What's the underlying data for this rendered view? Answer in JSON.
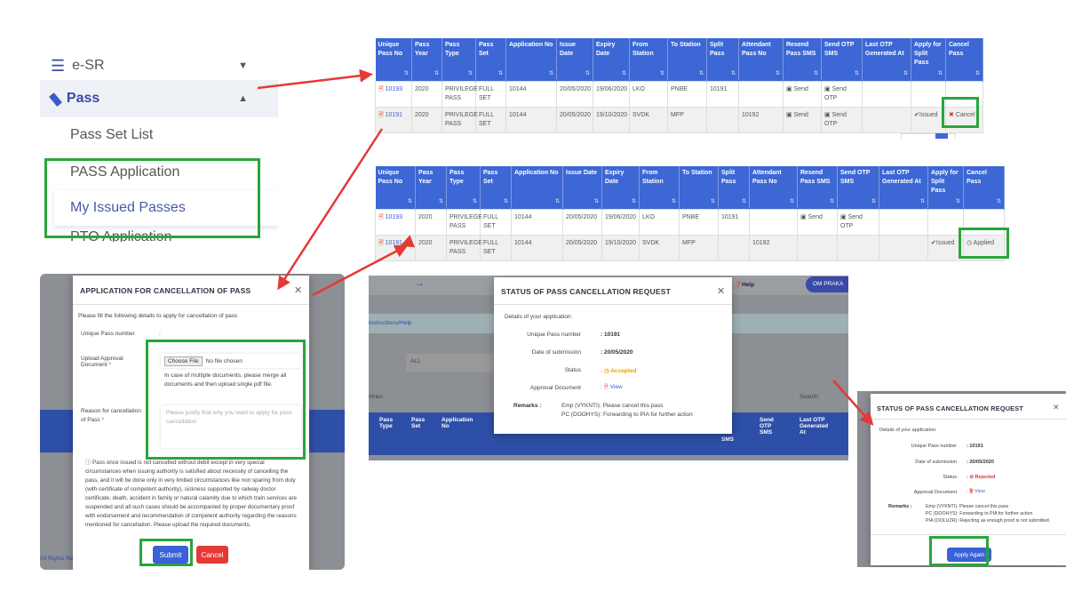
{
  "sidebar": {
    "items": [
      {
        "label": "e-SR",
        "icon": "database-icon"
      },
      {
        "label": "Pass",
        "icon": "ticket-icon"
      },
      {
        "label": "Pass Set List"
      },
      {
        "label": "PASS Application"
      },
      {
        "label": "My Issued Passes"
      },
      {
        "label": "PTO Application"
      }
    ]
  },
  "table_headers": [
    "Unique Pass No",
    "Pass Year",
    "Pass Type",
    "Pass Set",
    "Application No",
    "Issue Date",
    "Expiry Date",
    "From Station",
    "To Station",
    "Split Pass",
    "Attendant Pass No",
    "Resend Pass SMS",
    "Send OTP SMS",
    "Last OTP Generated At",
    "Apply for Split Pass",
    "Cancel Pass"
  ],
  "table1": {
    "rows": [
      [
        "10193",
        "2020",
        "PRIVILEGE PASS",
        "FULL SET",
        "10144",
        "20/05/2020",
        "19/06/2020",
        "LKO",
        "PNBE",
        "10191",
        "",
        "Send",
        "Send OTP",
        "",
        "",
        ""
      ],
      [
        "10191",
        "2020",
        "PRIVILEGE PASS",
        "FULL SET",
        "10144",
        "20/05/2020",
        "19/10/2020",
        "SVDK",
        "MFP",
        "",
        "10192",
        "Send",
        "Send OTP",
        "",
        "Issued",
        "Cancel"
      ]
    ]
  },
  "table2": {
    "rows": [
      [
        "10193",
        "2020",
        "PRIVILEGE PASS",
        "FULL SET",
        "10144",
        "20/05/2020",
        "19/06/2020",
        "LKO",
        "PNBE",
        "10191",
        "",
        "Send",
        "Send OTP",
        "",
        "",
        ""
      ],
      [
        "10191",
        "2020",
        "PRIVILEGE PASS",
        "FULL SET",
        "10144",
        "20/05/2020",
        "19/10/2020",
        "SVDK",
        "MFP",
        "",
        "10192",
        "",
        "",
        "",
        "Issued",
        "Applied"
      ]
    ]
  },
  "cancel_form": {
    "title": "APPLICATION FOR CANCELLATION OF PASS",
    "intro": "Please fill the following details to apply for cancellation of pass",
    "unique_pass_label": "Unique Pass number",
    "upload_label": "Upload Approval Document",
    "choose_file": "Choose File",
    "no_file": "No file chosen",
    "upload_hint": "In case of multiple documents, please merge all documents and then upload single pdf file.",
    "reason_label": "Reason for cancellation of Pass",
    "reason_placeholder": "Please justify that why you want to apply for pass cancellation",
    "notice": "Pass once issued is not cancelled without debit except in very special circumstances when issuing authority is satisfied about necessity of cancelling the pass, and it will be done only in very limited circumstances like non sparing from duty (with certificate of competent authority), sickness supported by railway doctor certificate, death, accident in family or natural calamity due to which train services are suspended and all such cases should be accompanied by proper documentary proof with endorsement and recommendation of competent authority regarding the reasons mentioned for cancellation. Please upload the required documents.",
    "submit": "Submit",
    "cancel": "Cancel",
    "bg_footer": "All Rights Re"
  },
  "status_accepted": {
    "title": "STATUS OF PASS CANCELLATION REQUEST",
    "intro": "Details of your application:",
    "pass_label": "Unique Pass number",
    "pass_value": ": 10191",
    "date_label": "Date of submission",
    "date_value": ": 20/05/2020",
    "status_label": "Status",
    "status_value": "Accepted",
    "doc_label": "Approval Document",
    "doc_value": "View",
    "remarks_label": "Remarks :",
    "remarks": [
      "Emp (VYKNTI): Please cancel this pass",
      "PC (DOOHYS): Forwarding to PIA for further action"
    ],
    "bg": {
      "help": "Help",
      "user": "OM PRAKA",
      "instructions": "Instructions/Help",
      "filter": "ALL",
      "entries": "ntries",
      "search": "Search:",
      "cols": [
        "Pass Type",
        "Pass Set",
        "Application No",
        "SMS",
        "Send OTP SMS",
        "Last OTP Generated At"
      ]
    }
  },
  "status_rejected": {
    "title": "STATUS OF PASS CANCELLATION REQUEST",
    "intro": "Details of your application:",
    "pass_label": "Unique Pass number",
    "pass_value": ": 10191",
    "date_label": "Date of submission",
    "date_value": ": 20/05/2020",
    "status_label": "Status",
    "status_value": "Rejected",
    "doc_label": "Approval Document",
    "doc_value": "View",
    "remarks_label": "Remarks :",
    "remarks": [
      "Emp (VYKNTI): Please cancel this pass",
      "PC (DOOHYS): Forwarding to PIA for further action",
      "PIA (OOLUZR): Rejecting as enough proof is not submitted."
    ],
    "apply_again": "Apply Again"
  },
  "colors": {
    "header_blue": "#3c67d4",
    "highlight_green": "#2aa63a",
    "arrow_red": "#e53935",
    "accepted": "#e6a100",
    "rejected": "#d93025",
    "issued": "#2aa84a"
  }
}
